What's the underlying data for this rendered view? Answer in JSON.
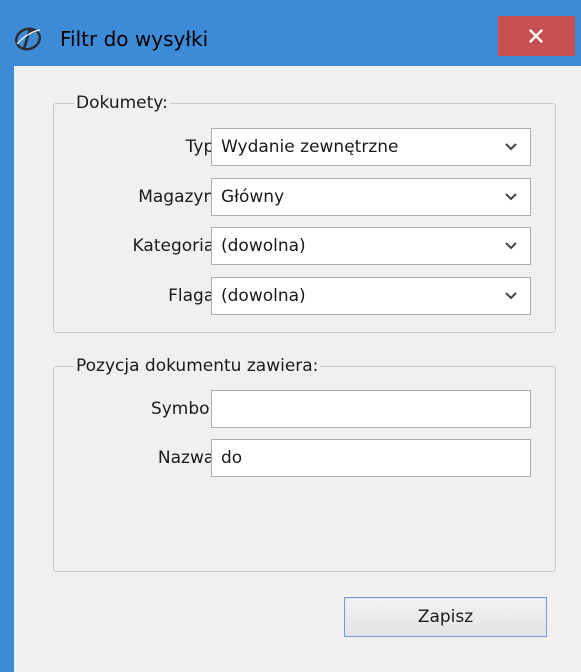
{
  "window": {
    "title": "Filtr do wysyłki",
    "close_label": "✕"
  },
  "documents_group": {
    "legend": "Dokumety:",
    "fields": [
      {
        "label": "Typ:",
        "value": "Wydanie zewnętrzne"
      },
      {
        "label": "Magazyn:",
        "value": "Główny"
      },
      {
        "label": "Kategoria:",
        "value": "(dowolna)"
      },
      {
        "label": "Flaga:",
        "value": "(dowolna)"
      }
    ]
  },
  "position_group": {
    "legend": "Pozycja dokumentu zawiera:",
    "fields": [
      {
        "label": "Symbol:",
        "value": ""
      },
      {
        "label": "Nazwa:",
        "value": "do"
      }
    ]
  },
  "buttons": {
    "save_label": "Zapisz"
  },
  "colors": {
    "titlebar": "#3d8ad6",
    "close_button": "#c75050",
    "client_background": "#f0f0f0"
  }
}
